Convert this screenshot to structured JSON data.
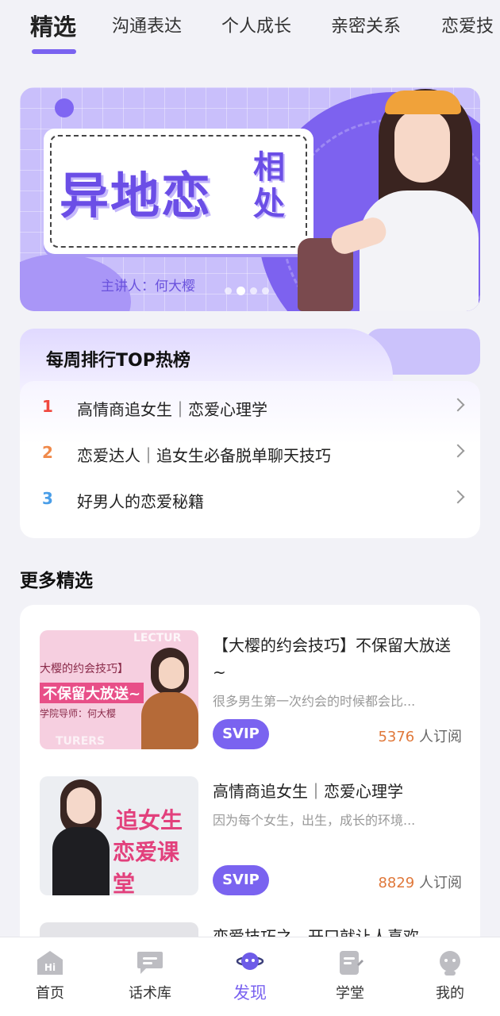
{
  "tabs": [
    {
      "label": "精选",
      "active": true
    },
    {
      "label": "沟通表达",
      "active": false
    },
    {
      "label": "个人成长",
      "active": false
    },
    {
      "label": "亲密关系",
      "active": false
    },
    {
      "label": "恋爱技",
      "active": false
    }
  ],
  "banner": {
    "title": "异地恋",
    "subtitle": "相处",
    "speaker": "主讲人：何大樱",
    "dot_count": 4,
    "active_dot": 1
  },
  "ranking": {
    "title": "每周排行TOP热榜",
    "items": [
      {
        "rank": "1",
        "text": "高情商追女生｜恋爱心理学",
        "color": "#f0483e"
      },
      {
        "rank": "2",
        "text": "恋爱达人｜追女生必备脱单聊天技巧",
        "color": "#f08a4b"
      },
      {
        "rank": "3",
        "text": "好男人的恋爱秘籍",
        "color": "#4a9ee8"
      }
    ]
  },
  "more": {
    "title": "更多精选",
    "courses": [
      {
        "title": "【大樱的约会技巧】不保留大放送~",
        "desc": "很多男生第一次约会的时候都会比...",
        "badge": "SVIP",
        "subs_count": "5376",
        "subs_label": " 人订阅",
        "thumb_lines": [
          "大樱的约会技巧】",
          "不保留大放送~",
          "学院导师：何大樱"
        ],
        "thumb_watermark_top": "LECTUR",
        "thumb_watermark_bottom": "TURERS"
      },
      {
        "title": "高情商追女生｜恋爱心理学",
        "desc": "因为每个女生，出生，成长的环境...",
        "badge": "SVIP",
        "subs_count": "8829",
        "subs_label": " 人订阅",
        "thumb_lines": [
          "追女生",
          "恋爱课堂"
        ]
      },
      {
        "title": "恋爱技巧之，开口就让人喜欢"
      }
    ]
  },
  "bottom_nav": [
    {
      "label": "首页",
      "icon": "home-hi-icon",
      "active": false
    },
    {
      "label": "话术库",
      "icon": "chat-bubble-icon",
      "active": false
    },
    {
      "label": "发现",
      "icon": "planet-face-icon",
      "active": true
    },
    {
      "label": "学堂",
      "icon": "notebook-icon",
      "active": false
    },
    {
      "label": "我的",
      "icon": "avatar-icon",
      "active": false
    }
  ],
  "colors": {
    "accent": "#7a63f0",
    "subs_number": "#e0783a",
    "page_bg": "#f2f2f7"
  },
  "home_icon_text": "Hi"
}
